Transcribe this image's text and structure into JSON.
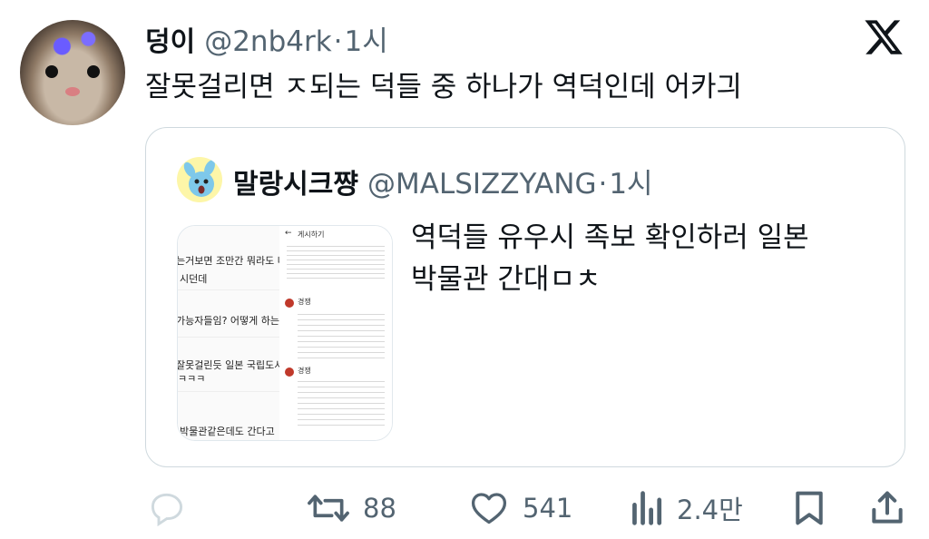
{
  "tweet": {
    "author_name": "덩이",
    "author_handle": "@2nb4rk",
    "time": "1시",
    "text": "잘못걸리면 ㅈ되는 덕들 중 하나가 역덕인데 어카긔"
  },
  "quote": {
    "author_name": "말랑시크쨩",
    "author_handle": "@MALSIZZYANG",
    "time": "1시",
    "text": "역덕들 유우시 족보 확인하러 일본\n박물관 간대ㅁㅊ",
    "image": {
      "left_lines": [
        "는거보면 조만간 뭐라도 나올듯",
        "시던데",
        "가능자들임? 어떻게 하는건데",
        "잘못걸린듯 일본 국립도서관",
        "ㅋㅋㅋ",
        "박물관같은데도 간다고 "
      ],
      "right_header": "게시하기",
      "right_user": "경쟁"
    }
  },
  "actions": {
    "reply_count": "",
    "retweet_count": "88",
    "like_count": "541",
    "views_count": "2.4만"
  },
  "icons": {
    "logo": "x-logo-icon",
    "reply": "reply-icon",
    "retweet": "retweet-icon",
    "like": "heart-icon",
    "views": "views-icon",
    "bookmark": "bookmark-icon",
    "share": "share-icon"
  },
  "colors": {
    "text": "#0f1419",
    "muted": "#536471",
    "border": "#cfd9de"
  }
}
